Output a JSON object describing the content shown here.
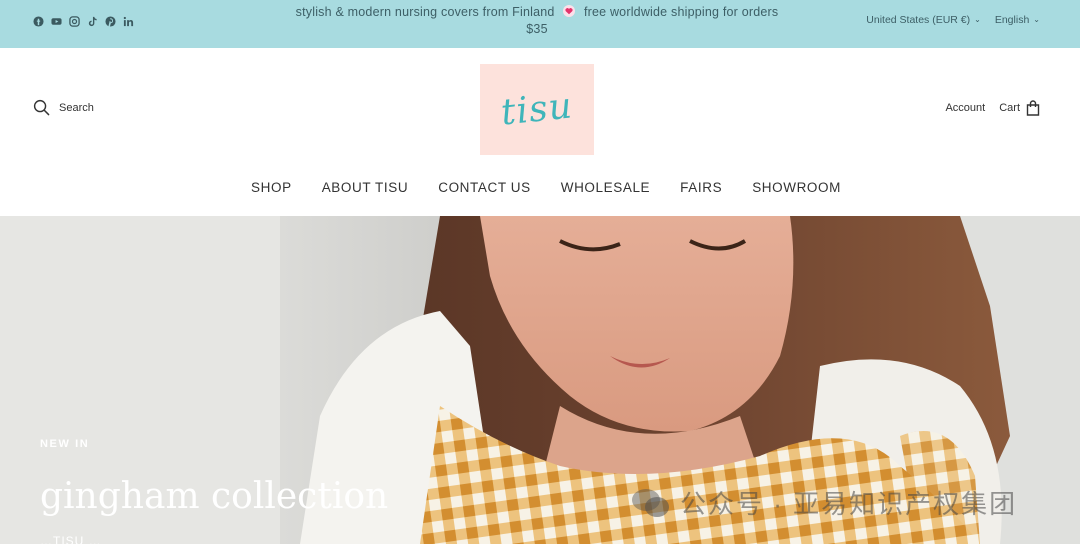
{
  "announcement": {
    "text_before": "stylish & modern nursing covers from Finland",
    "text_after": "free worldwide shipping for orders",
    "text_line2": "$35"
  },
  "social_icons": [
    "facebook-icon",
    "youtube-icon",
    "instagram-icon",
    "tiktok-icon",
    "pinterest-icon",
    "linkedin-icon"
  ],
  "locale": {
    "country": "United States (EUR €)",
    "language": "English"
  },
  "header": {
    "search_label": "Search",
    "logo_text": "tisu",
    "account_label": "Account",
    "cart_label": "Cart"
  },
  "nav": [
    "SHOP",
    "ABOUT TISU",
    "CONTACT US",
    "WHOLESALE",
    "FAIRS",
    "SHOWROOM"
  ],
  "hero": {
    "tag": "NEW IN",
    "title": "gingham collection",
    "subtitle": "…TISU …"
  },
  "watermark": {
    "text": "公众号 · 亚易知识产权集团"
  },
  "colors": {
    "announcement_bg": "#a8dbe0",
    "logo_bg": "#fde2dc",
    "logo_text": "#3fb5ba"
  }
}
